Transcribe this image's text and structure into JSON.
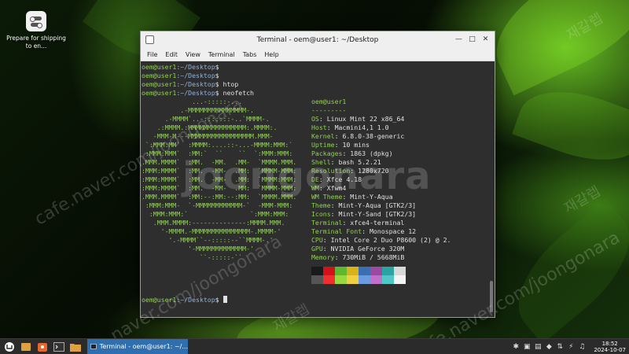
{
  "desktop": {
    "icon_label": "Prepare for shipping to en..."
  },
  "window": {
    "title": "Terminal - oem@user1: ~/Desktop",
    "menu": [
      "File",
      "Edit",
      "View",
      "Terminal",
      "Tabs",
      "Help"
    ]
  },
  "terminal": {
    "prompt_user": "oem@user1",
    "prompt_path": ":~/Desktop",
    "prompt_symbol": "$",
    "commands": [
      "",
      "",
      "htop",
      "neofetch"
    ],
    "logo_lines": [
      "             ...-:::::-...",
      "          .-MMMMMMMMMMMMMMM-.",
      "      .-MMMM`..-:::::::-..`MMMM-.",
      "    .:MMMM.:MMMMMMMMMMMMMMM:.MMMM:.",
      "   -MMM-M---MMMMMMMMMMMMMMMMM.MMM-",
      " `:MMM:MM`  :MMMM:....::-...-MMMM:MMM:`",
      " :MMM:MMM`  :MM:`  ``    ``  `:MMM:MMM:",
      ".MMM.MMMM`  :MM.  -MM.  .MM-  `MMMM.MMM.",
      ":MMM:MMMM`  :MM.  -MM-  .MM:  `MMMM-MMM:",
      ":MMM:MMMM`  :MM.  -MM-  .MM:  `MMMM:MMM:",
      ":MMM:MMMM`  :MM.  -MM-  .MM:  `MMMM-MMM:",
      ".MMM.MMMM`  :MM:--:MM:--:MM:  `MMMM.MMM.",
      " :MMM:MMM-  `-MMMMMMMMMMMM-`  -MMM-MMM:",
      "  :MMM:MMM:`                `:MMM:MMM:",
      "   .MMM.MMMM:--------------:MMMM.MMM.",
      "     '-MMMM.-MMMMMMMMMMMMMMM-.MMMM-'",
      "       '.-MMMM``--:::::--``MMMM-.'",
      "            '-MMMMMMMMMMMMM-'",
      "               ``-:::::-``"
    ],
    "info_header": "oem@user1",
    "info_separator": "---------",
    "info": [
      {
        "k": "OS",
        "v": "Linux Mint 22 x86_64"
      },
      {
        "k": "Host",
        "v": "Macmini4,1 1.0"
      },
      {
        "k": "Kernel",
        "v": "6.8.0-38-generic"
      },
      {
        "k": "Uptime",
        "v": "10 mins"
      },
      {
        "k": "Packages",
        "v": "1863 (dpkg)"
      },
      {
        "k": "Shell",
        "v": "bash 5.2.21"
      },
      {
        "k": "Resolution",
        "v": "1280x720"
      },
      {
        "k": "DE",
        "v": "Xfce 4.18"
      },
      {
        "k": "WM",
        "v": "Xfwm4"
      },
      {
        "k": "WM Theme",
        "v": "Mint-Y-Aqua"
      },
      {
        "k": "Theme",
        "v": "Mint-Y-Aqua [GTK2/3]"
      },
      {
        "k": "Icons",
        "v": "Mint-Y-Sand [GTK2/3]"
      },
      {
        "k": "Terminal",
        "v": "xfce4-terminal"
      },
      {
        "k": "Terminal Font",
        "v": "Monospace 12"
      },
      {
        "k": "CPU",
        "v": "Intel Core 2 Duo P8600 (2) @ 2."
      },
      {
        "k": "GPU",
        "v": "NVIDIA GeForce 320M"
      },
      {
        "k": "Memory",
        "v": "730MiB / 5668MiB"
      }
    ],
    "palette_row1": [
      "#1a1a1a",
      "#d0121a",
      "#5fb62f",
      "#d8b21a",
      "#3b6fb0",
      "#9a4aa0",
      "#2aa3a3",
      "#d8d8d8"
    ],
    "palette_row2": [
      "#555555",
      "#f03030",
      "#9ad840",
      "#f0d040",
      "#6a9ae0",
      "#c070c8",
      "#50c8c8",
      "#f4f4f4"
    ]
  },
  "watermark": {
    "main": "joongonara",
    "url": "cafe.naver.com/joongonara",
    "korean": "재갈렙"
  },
  "taskbar": {
    "task_label": "Terminal - oem@user1: ~/...",
    "time": "18:52",
    "date": "2024-10-07"
  },
  "colors": {
    "prompt_green": "#8fd14f",
    "path_blue": "#8fb0e0",
    "task_active": "#2f6fb0"
  }
}
